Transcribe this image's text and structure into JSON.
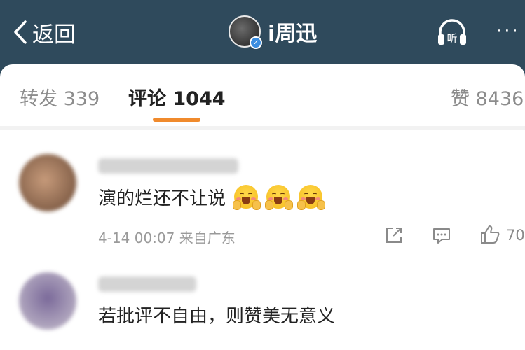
{
  "header": {
    "back_label": "返回",
    "title": "i周迅",
    "listen_label": "听",
    "more_label": "···"
  },
  "tabs": [
    {
      "label": "转发 339",
      "active": false
    },
    {
      "label": "评论 1044",
      "active": true
    },
    {
      "label": "赞 8436",
      "active": false
    }
  ],
  "comments": [
    {
      "text": "演的烂还不让说",
      "emojis": [
        "grinning-emoji",
        "grinning-emoji",
        "grinning-emoji"
      ],
      "meta": "4-14 00:07 来自广东",
      "like_count": "70"
    },
    {
      "text": "若批评不自由，则赞美无意义"
    }
  ],
  "colors": {
    "header_bg": "#2f4a5c",
    "tab_indicator": "#f08a2c",
    "verify_badge": "#3a8de0"
  }
}
